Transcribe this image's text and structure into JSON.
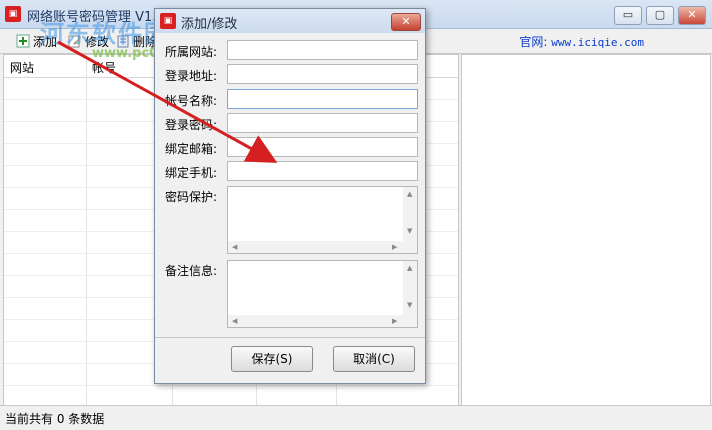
{
  "app": {
    "title": "网络账号密码管理 V1.7",
    "website_label": "官网:",
    "website_url": "www.iciqie.com",
    "window_controls": {
      "minimize": "▭",
      "maximize": "▢",
      "close": "✕"
    }
  },
  "toolbar": {
    "add_label": "添加",
    "edit_label": "修改",
    "delete_label": "删除"
  },
  "list": {
    "columns": [
      "网站",
      "帐号"
    ]
  },
  "status": {
    "text": "当前共有 0 条数据"
  },
  "watermark": {
    "line1": "河东软件园",
    "line2": "www.pc0359.cn"
  },
  "dialog": {
    "title": "添加/修改",
    "close": "✕",
    "fields": {
      "site": "所属网站:",
      "login_url": "登录地址:",
      "account": "帐号名称:",
      "password": "登录密码:",
      "email": "绑定邮箱:",
      "phone": "绑定手机:",
      "security": "密码保护:",
      "notes": "备注信息:"
    },
    "values": {
      "site": "",
      "login_url": "",
      "account": "",
      "password": "",
      "email": "",
      "phone": "",
      "security": "",
      "notes": ""
    },
    "save_label": "保存(S)",
    "cancel_label": "取消(C)"
  },
  "colors": {
    "arrow": "#d42020",
    "link": "#0a3cc8",
    "title_bar": "#cddbee"
  }
}
